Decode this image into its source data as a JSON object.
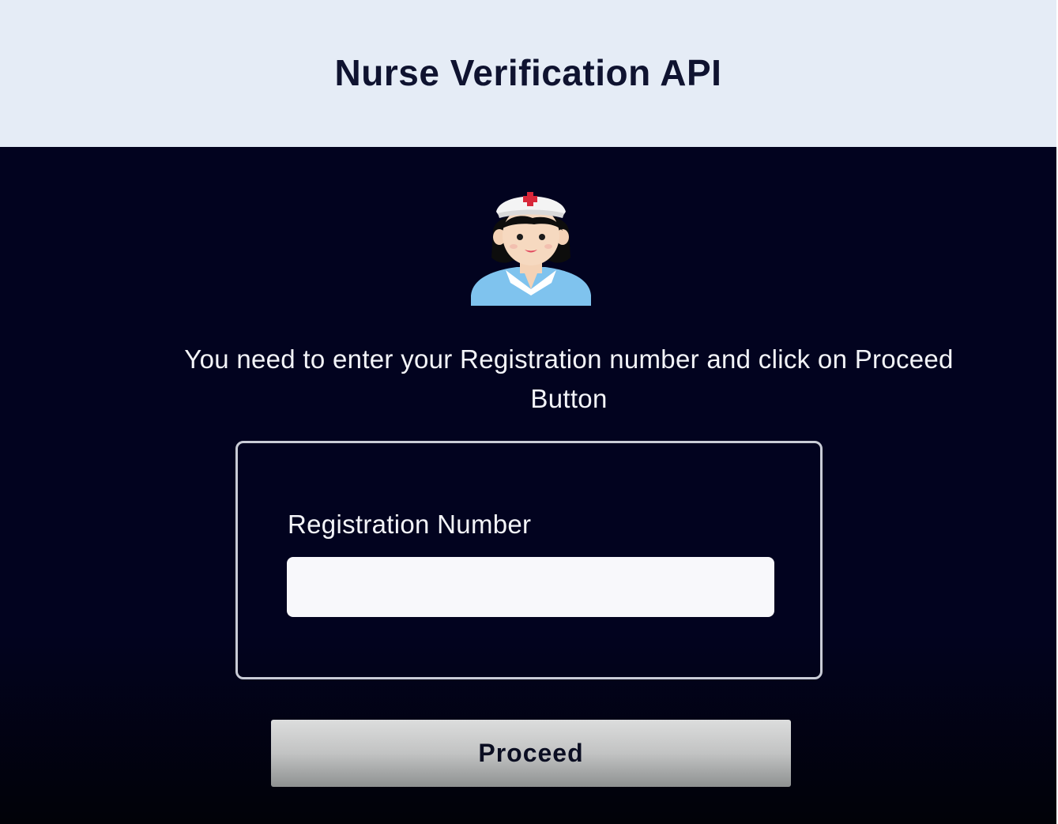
{
  "header": {
    "title": "Nurse Verification API"
  },
  "main": {
    "avatar_icon": "nurse-icon",
    "instructions": "You need to enter your Registration number and click on Proceed Button",
    "form": {
      "label": "Registration Number",
      "input_value": "",
      "input_placeholder": ""
    },
    "proceed_label": "Proceed"
  },
  "colors": {
    "header_bg": "#e5ecf6",
    "page_bg": "#02031c",
    "title_text": "#0f1330",
    "body_text": "#f3f4f8",
    "card_border": "#c9ccd6",
    "button_bg": "#c2c3c3"
  }
}
